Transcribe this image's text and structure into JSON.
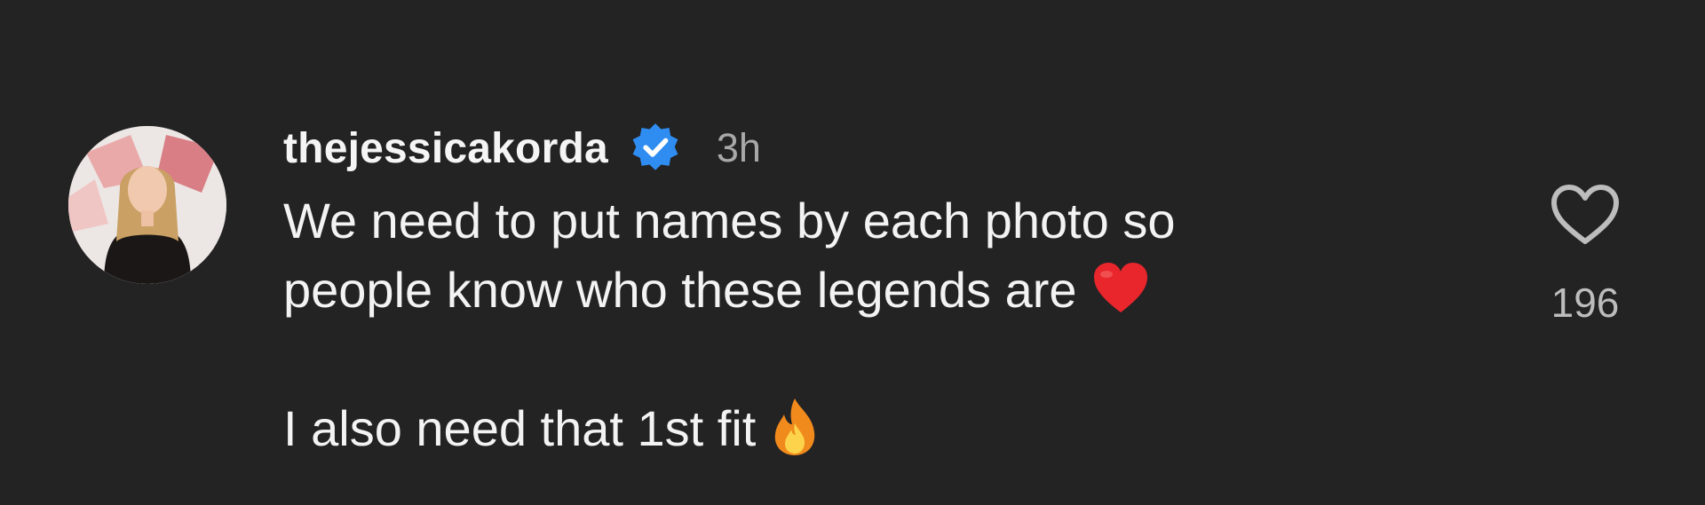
{
  "comment": {
    "username": "thejessicakorda",
    "verified_icon": "verified-badge-icon",
    "timestamp": "3h",
    "text_line_1": "We need to put names by each photo so",
    "text_line_2": "people know who these legends are",
    "text_line_2_emoji": "red-heart-emoji",
    "text_line_3": "I also need that 1st fit",
    "text_line_3_emoji": "fire-emoji",
    "like_icon": "heart-outline-icon",
    "like_count": "196"
  },
  "colors": {
    "background": "#232324",
    "verified_blue": "#2f8cf0",
    "heart_red": "#e8262c",
    "timestamp_gray": "#a8a8a8"
  }
}
